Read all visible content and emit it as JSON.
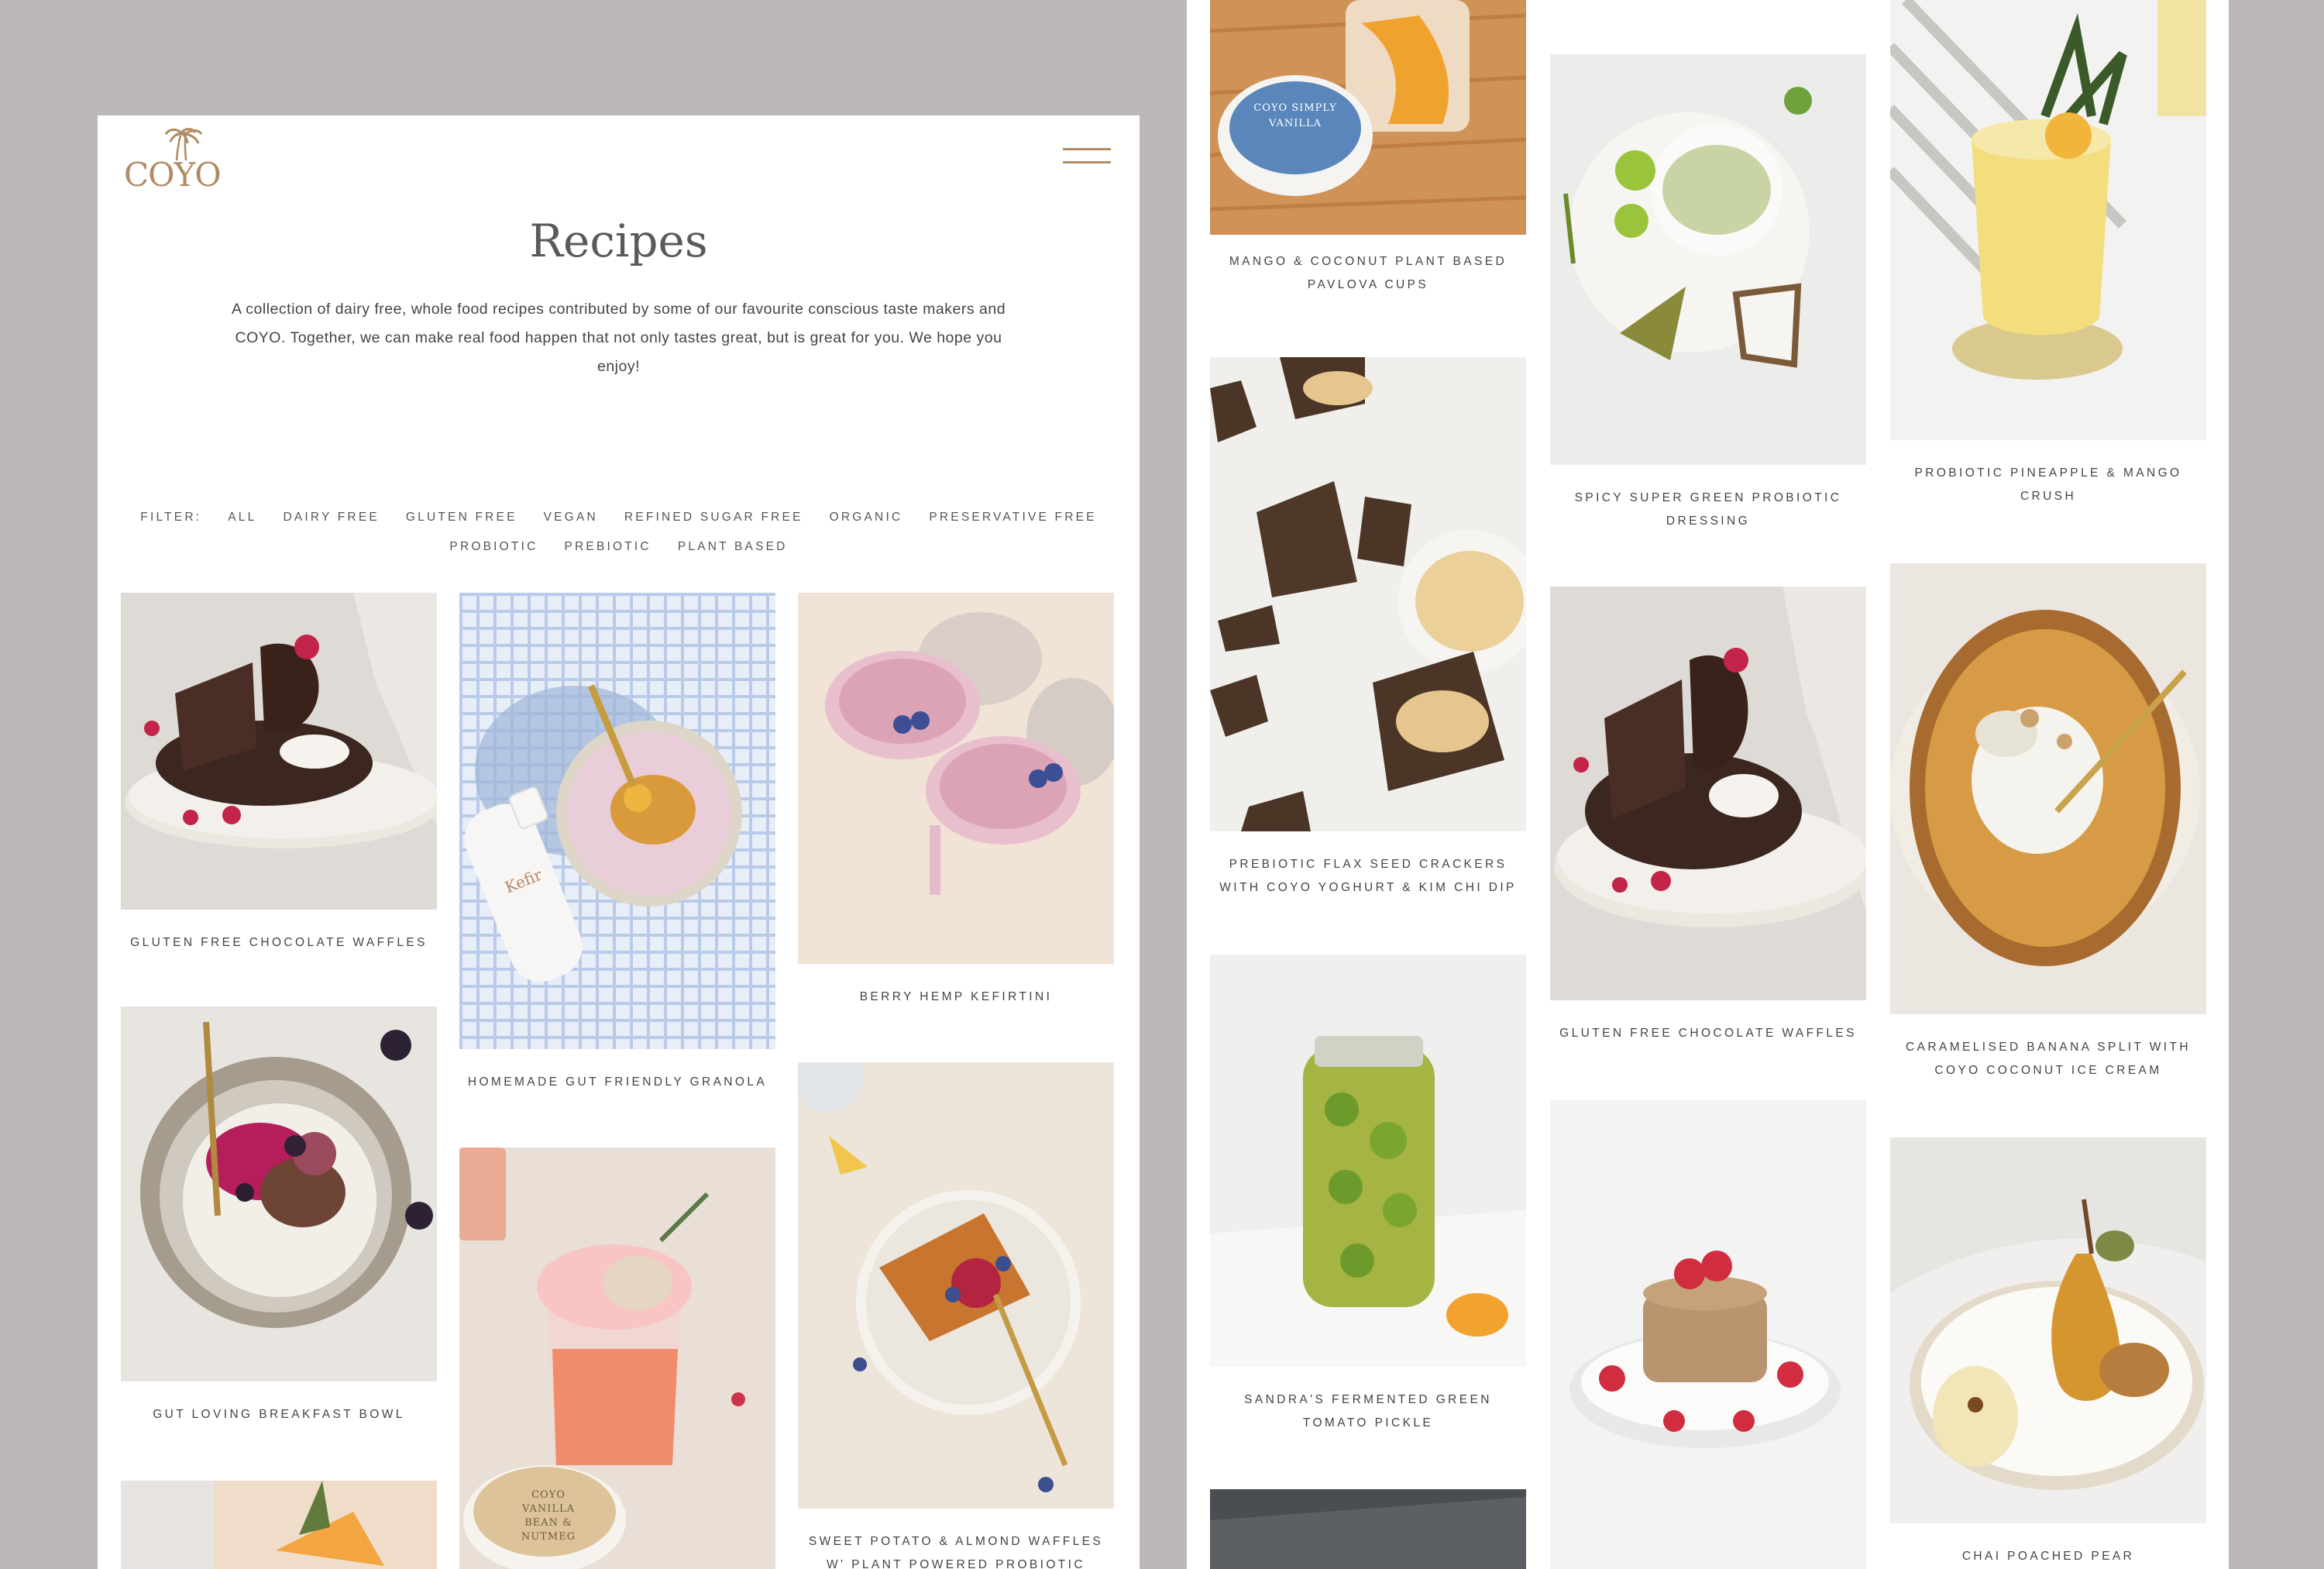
{
  "brand": {
    "logo_text": "COYO",
    "accent": "#b08b63"
  },
  "header": {
    "menu_icon": "hamburger-icon"
  },
  "page": {
    "title": "Recipes",
    "intro": "A collection of dairy free, whole food recipes contributed by some of our favourite conscious taste makers and COYO. Together, we can make real food happen that not only tastes great, but is great for you. We hope you enjoy!"
  },
  "filter": {
    "label": "FILTER:",
    "items": [
      "ALL",
      "DAIRY FREE",
      "GLUTEN FREE",
      "VEGAN",
      "REFINED SUGAR FREE",
      "ORGANIC",
      "PRESERVATIVE FREE",
      "PROBIOTIC",
      "PREBIOTIC",
      "PLANT BASED"
    ]
  },
  "left_recipes": [
    {
      "title": "GLUTEN FREE CHOCOLATE WAFFLES"
    },
    {
      "title": "HOMEMADE GUT FRIENDLY GRANOLA",
      "product_label": "Kefir"
    },
    {
      "title": "BERRY HEMP KEFIRTINI"
    },
    {
      "title": "GUT LOVING BREAKFAST BOWL"
    },
    {
      "title": "",
      "product_label": "COYO VANILLA BEAN & NUTMEG"
    },
    {
      "title": "SWEET POTATO & ALMOND WAFFLES W' PLANT POWERED PROBIOTIC"
    },
    {
      "title": ""
    }
  ],
  "right_recipes": [
    {
      "title": "MANGO & COCONUT PLANT BASED PAVLOVA CUPS",
      "product_label": "COYO SIMPLY VANILLA"
    },
    {
      "title": "SPICY SUPER GREEN PROBIOTIC DRESSING"
    },
    {
      "title": "PROBIOTIC PINEAPPLE & MANGO CRUSH"
    },
    {
      "title": "PREBIOTIC FLAX SEED CRACKERS WITH COYO YOGHURT & KIM CHI DIP"
    },
    {
      "title": "GLUTEN FREE CHOCOLATE WAFFLES"
    },
    {
      "title": "CARAMELISED BANANA SPLIT WITH COYO COCONUT ICE CREAM"
    },
    {
      "title": "SANDRA'S FERMENTED GREEN TOMATO PICKLE"
    },
    {
      "title": ""
    },
    {
      "title": "CHAI POACHED PEAR"
    },
    {
      "title": ""
    }
  ]
}
